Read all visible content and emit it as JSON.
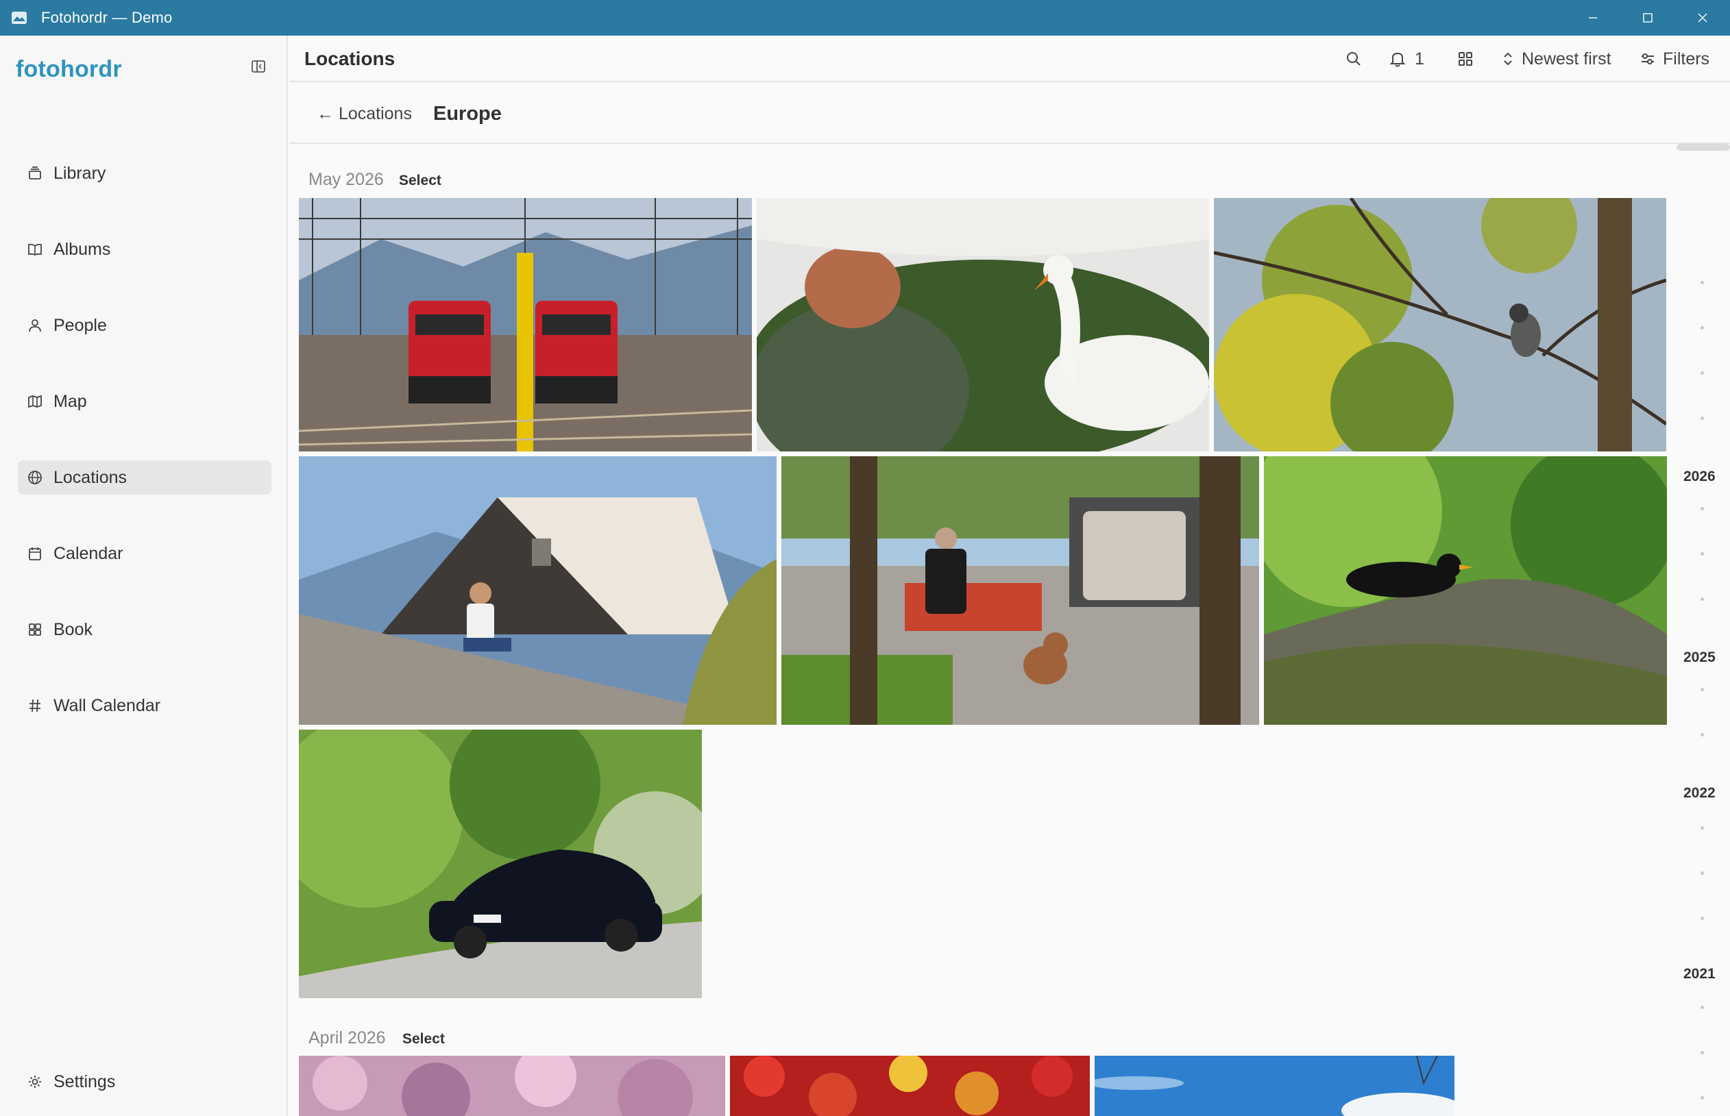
{
  "window": {
    "title": "Fotohordr — Demo",
    "controls": [
      "minimize",
      "maximize",
      "close"
    ]
  },
  "sidebar": {
    "brand": "fotohordr",
    "items": [
      {
        "label": "Library",
        "icon": "library-icon"
      },
      {
        "label": "Albums",
        "icon": "book-open-icon"
      },
      {
        "label": "People",
        "icon": "person-icon"
      },
      {
        "label": "Map",
        "icon": "map-icon"
      },
      {
        "label": "Locations",
        "icon": "globe-icon",
        "active": true
      },
      {
        "label": "Calendar",
        "icon": "calendar-icon"
      },
      {
        "label": "Book",
        "icon": "grid-icon"
      },
      {
        "label": "Wall Calendar",
        "icon": "hash-icon"
      }
    ],
    "settings_label": "Settings"
  },
  "topbar": {
    "title": "Locations",
    "notifications_count": "1",
    "sort_label": "Newest first",
    "filters_label": "Filters"
  },
  "breadcrumb": {
    "back_label": "← Locations",
    "current": "Europe"
  },
  "sections": [
    {
      "title": "May 2026",
      "select_label": "Select",
      "photos": [
        "red-trains-photo",
        "swan-photo",
        "bird-on-branch-photo",
        "man-on-wall-photo",
        "man-on-bench-with-dog-photo",
        "blackbird-photo",
        "black-sports-car-photo"
      ]
    },
    {
      "title": "April 2026",
      "select_label": "Select",
      "photos": [
        "pink-blossoms-photo",
        "tulips-photo",
        "blue-sky-photo"
      ]
    }
  ],
  "timeline": {
    "years": [
      "2026",
      "2025",
      "2022",
      "2021"
    ]
  },
  "colors": {
    "titlebar": "#2a7aa1",
    "brand": "#2f93bf",
    "active_item": "#e6e6e6"
  }
}
